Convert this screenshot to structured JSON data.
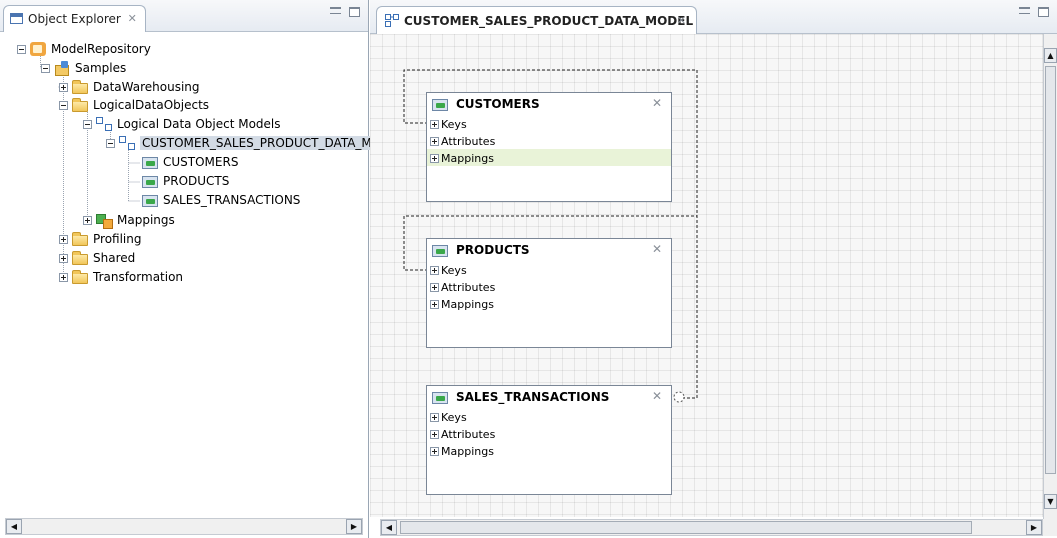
{
  "explorer": {
    "tab_label": "Object Explorer",
    "tree": [
      {
        "label": "ModelRepository",
        "icon": "repository-icon"
      },
      {
        "label": "Samples",
        "icon": "project-icon"
      },
      {
        "label": "DataWarehousing",
        "icon": "folder-icon"
      },
      {
        "label": "LogicalDataObjects",
        "icon": "folder-icon"
      },
      {
        "label": "Logical Data Object Models",
        "icon": "model-icon"
      },
      {
        "label": "CUSTOMER_SALES_PRODUCT_DATA_MO",
        "icon": "model-icon"
      },
      {
        "label": "CUSTOMERS",
        "icon": "logical-data-object-icon"
      },
      {
        "label": "PRODUCTS",
        "icon": "logical-data-object-icon"
      },
      {
        "label": "SALES_TRANSACTIONS",
        "icon": "logical-data-object-icon"
      },
      {
        "label": "Mappings",
        "icon": "mapping-icon"
      },
      {
        "label": "Profiling",
        "icon": "folder-icon"
      },
      {
        "label": "Shared",
        "icon": "folder-icon"
      },
      {
        "label": "Transformation",
        "icon": "folder-icon"
      }
    ]
  },
  "editor": {
    "tab_label": "CUSTOMER_SALES_PRODUCT_DATA_MODEL",
    "entities": [
      {
        "name": "CUSTOMERS",
        "sections": [
          "Keys",
          "Attributes",
          "Mappings"
        ]
      },
      {
        "name": "PRODUCTS",
        "sections": [
          "Keys",
          "Attributes",
          "Mappings"
        ]
      },
      {
        "name": "SALES_TRANSACTIONS",
        "sections": [
          "Keys",
          "Attributes",
          "Mappings"
        ]
      }
    ],
    "highlight_color": "#e9f3d8",
    "selection_color": "#d3dbe5"
  }
}
